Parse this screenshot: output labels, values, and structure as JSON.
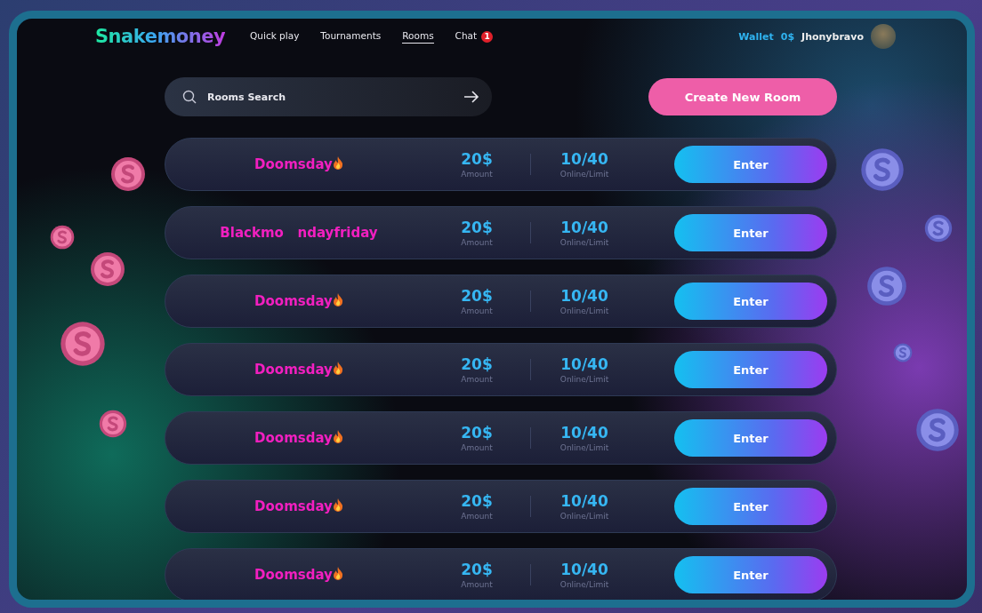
{
  "logo": "Snakemoney",
  "nav": [
    {
      "label": "Quick play",
      "selected": false
    },
    {
      "label": "Tournaments",
      "selected": false
    },
    {
      "label": "Rooms",
      "selected": true
    },
    {
      "label": "Chat",
      "selected": false,
      "badge": "1"
    }
  ],
  "account": {
    "wallet_label": "Wallet",
    "balance": "0$",
    "username": "Jhonybravo"
  },
  "search": {
    "placeholder": "Rooms Search"
  },
  "create_button": "Create New Room",
  "rooms": [
    {
      "name": "Doomsday",
      "hot": true,
      "amount": "20$",
      "amount_label": "Amount",
      "online": "10/40",
      "online_label": "Online/Limit",
      "action": "Enter"
    },
    {
      "name": "Blackmo   ndayfriday",
      "hot": false,
      "amount": "20$",
      "amount_label": "Amount",
      "online": "10/40",
      "online_label": "Online/Limit",
      "action": "Enter"
    },
    {
      "name": "Doomsday",
      "hot": true,
      "amount": "20$",
      "amount_label": "Amount",
      "online": "10/40",
      "online_label": "Online/Limit",
      "action": "Enter"
    },
    {
      "name": "Doomsday",
      "hot": true,
      "amount": "20$",
      "amount_label": "Amount",
      "online": "10/40",
      "online_label": "Online/Limit",
      "action": "Enter"
    },
    {
      "name": "Doomsday",
      "hot": true,
      "amount": "20$",
      "amount_label": "Amount",
      "online": "10/40",
      "online_label": "Online/Limit",
      "action": "Enter"
    },
    {
      "name": "Doomsday",
      "hot": true,
      "amount": "20$",
      "amount_label": "Amount",
      "online": "10/40",
      "online_label": "Online/Limit",
      "action": "Enter"
    },
    {
      "name": "Doomsday",
      "hot": true,
      "amount": "20$",
      "amount_label": "Amount",
      "online": "10/40",
      "online_label": "Online/Limit",
      "action": "Enter"
    }
  ]
}
